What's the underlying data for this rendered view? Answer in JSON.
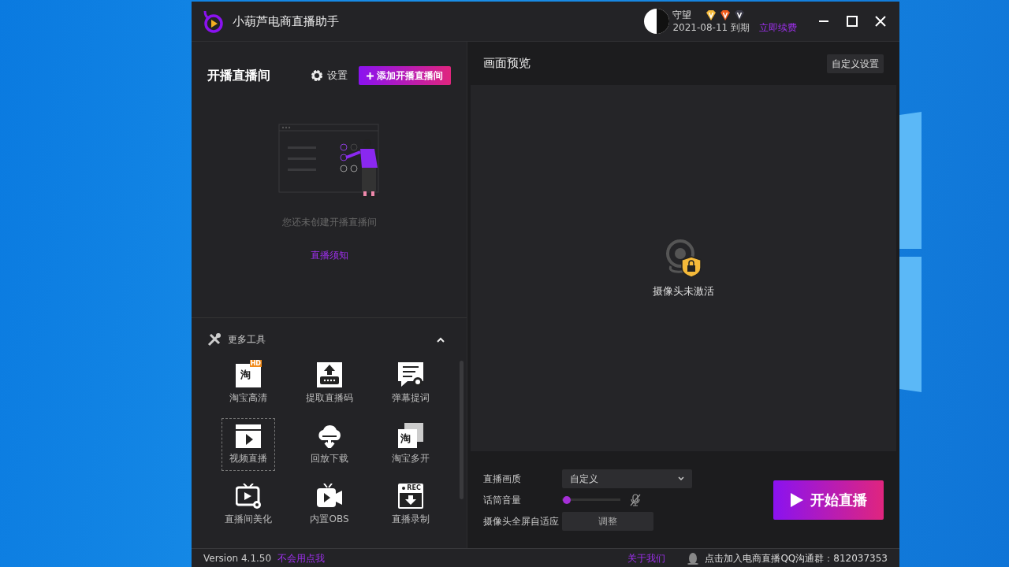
{
  "app": {
    "title": "小葫芦电商直播助手"
  },
  "user": {
    "name": "守望",
    "expiry": "2021-08-11 到期",
    "renew": "立即续费"
  },
  "rooms": {
    "title": "开播直播间",
    "settings": "设置",
    "add_button": "添加开播直播间",
    "empty_text": "您还未创建开播直播间",
    "notice_link": "直播须知"
  },
  "tools": {
    "title": "更多工具",
    "expanded": true,
    "items": [
      {
        "label": "淘宝高清",
        "kind": "taobao-hd",
        "glyph": "淘",
        "badge": "HD",
        "focused": false
      },
      {
        "label": "提取直播码",
        "kind": "code",
        "focused": false
      },
      {
        "label": "弹幕提词",
        "kind": "prompt",
        "focused": false
      },
      {
        "label": "视频直播",
        "kind": "video",
        "focused": true
      },
      {
        "label": "回放下载",
        "kind": "download",
        "focused": false
      },
      {
        "label": "淘宝多开",
        "kind": "taobao-multi",
        "glyph": "淘",
        "focused": false
      },
      {
        "label": "直播间美化",
        "kind": "tv",
        "focused": false
      },
      {
        "label": "内置OBS",
        "kind": "camera",
        "focused": false
      },
      {
        "label": "直播录制",
        "kind": "record",
        "badge": "REC",
        "focused": false
      }
    ]
  },
  "preview": {
    "title": "画面预览",
    "custom_button": "自定义设置",
    "camera_status": "摄像头未激活"
  },
  "controls": {
    "quality_label": "直播画质",
    "quality_value": "自定义",
    "mic": {
      "label": "话筒音量",
      "level": 0.02,
      "muted": true
    },
    "fit_label": "摄像头全屏自适应",
    "fit_button": "调整",
    "start_button": "开始直播"
  },
  "status_bar": {
    "version": "Version 4.1.50",
    "help_link": "不会用点我",
    "about_link": "关于我们",
    "qq_group": "点击加入电商直播QQ沟通群：812037353"
  }
}
